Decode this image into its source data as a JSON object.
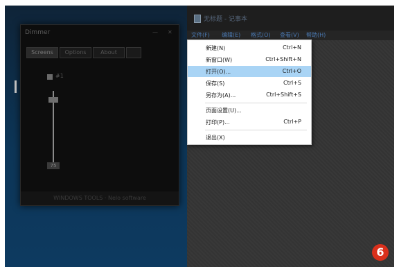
{
  "notepad": {
    "window_title": "无标题 - 记事本",
    "menubar": [
      "文件(F)",
      "编辑(E)",
      "格式(O)",
      "查看(V)",
      "帮助(H)"
    ]
  },
  "file_menu": {
    "items": [
      {
        "label": "新建(N)",
        "shortcut": "Ctrl+N"
      },
      {
        "label": "新窗口(W)",
        "shortcut": "Ctrl+Shift+N"
      },
      {
        "label": "打开(O)...",
        "shortcut": "Ctrl+O"
      },
      {
        "label": "保存(S)",
        "shortcut": "Ctrl+S"
      },
      {
        "label": "另存为(A)...",
        "shortcut": "Ctrl+Shift+S"
      },
      {
        "label": "页面设置(U)...",
        "shortcut": ""
      },
      {
        "label": "打印(P)...",
        "shortcut": "Ctrl+P"
      },
      {
        "label": "退出(X)",
        "shortcut": ""
      }
    ],
    "highlighted_index": 2
  },
  "dimmer": {
    "title": "Dimmer",
    "title_buttons": [
      "—",
      "✕"
    ],
    "tabs": [
      "Screens",
      "Options",
      "About"
    ],
    "monitor_label": "#1",
    "value_label": "75",
    "footer": "WINDOWS TOOLS · Nelo software"
  },
  "step_badge": "6",
  "colors": {
    "menu_highlight": "#a9d4f5",
    "badge": "#d9301c",
    "desktop": "#0d3658"
  }
}
